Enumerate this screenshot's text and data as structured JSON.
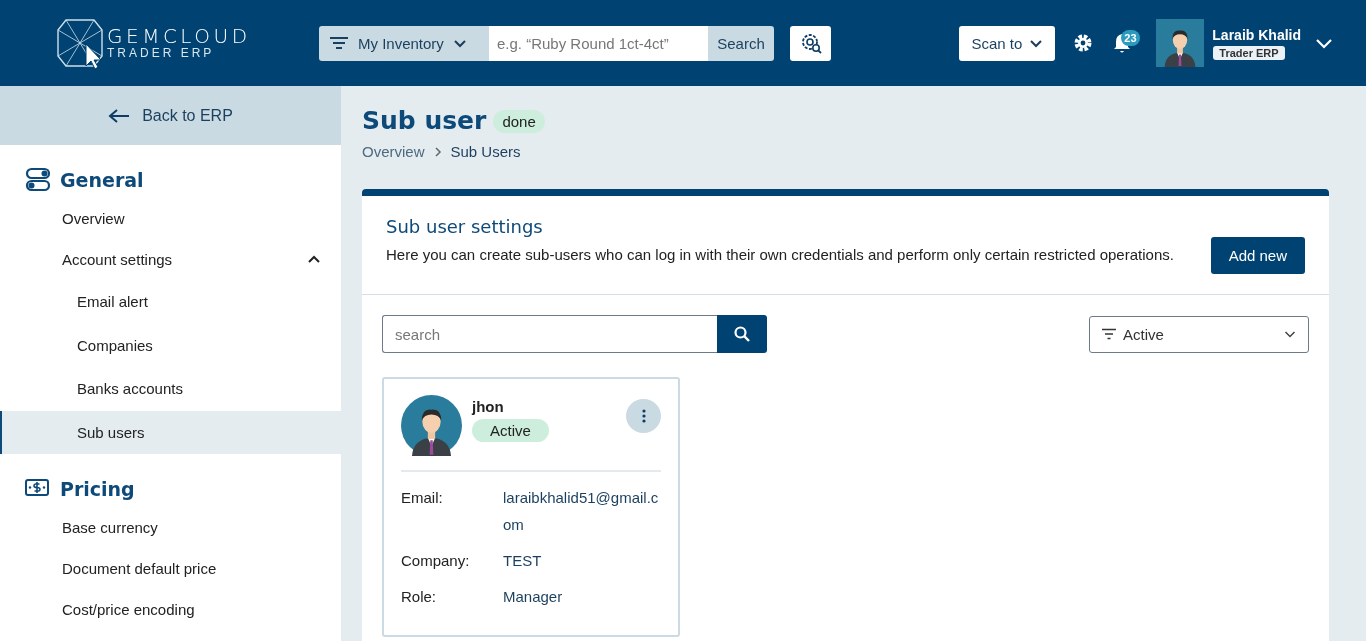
{
  "header": {
    "logo": {
      "name": "GEMCLOUD",
      "tagline": "TRADER ERP"
    },
    "search": {
      "scope": "My Inventory",
      "placeholder": "e.g. “Ruby Round 1ct-4ct”",
      "button": "Search"
    },
    "scan_button": "Scan to",
    "notifications": {
      "count": "23"
    },
    "user": {
      "name": "Laraib Khalid",
      "role": "Trader ERP"
    }
  },
  "sidebar": {
    "back": "Back to ERP",
    "sections": [
      {
        "title": "General",
        "kind": "toggles",
        "items": [
          {
            "label": "Overview",
            "selected": false
          },
          {
            "label": "Account settings",
            "selected": false,
            "expanded": true,
            "children": [
              {
                "label": "Email alert",
                "selected": false
              },
              {
                "label": "Companies",
                "selected": false
              },
              {
                "label": "Banks accounts",
                "selected": false
              },
              {
                "label": "Sub users",
                "selected": true
              }
            ]
          }
        ]
      },
      {
        "title": "Pricing",
        "kind": "money",
        "items": [
          {
            "label": "Base currency",
            "selected": false
          },
          {
            "label": "Document default price",
            "selected": false
          },
          {
            "label": "Cost/price encoding",
            "selected": false
          }
        ]
      }
    ]
  },
  "main": {
    "title": "Sub user",
    "badge": "done",
    "breadcrumb": [
      "Overview",
      "Sub Users"
    ],
    "card": {
      "title": "Sub user settings",
      "description": "Here you can create sub-users who can log in with their own credentials and perform only certain restricted operations.",
      "add_button": "Add new",
      "search": {
        "placeholder": "search"
      },
      "filter": {
        "value": "Active"
      },
      "users": [
        {
          "name": "jhon",
          "status": "Active",
          "fields": [
            {
              "label": "Email:",
              "value": "laraibkhalid51@gmail.com"
            },
            {
              "label": "Company:",
              "value": "TEST"
            },
            {
              "label": "Role:",
              "value": "Manager"
            }
          ]
        }
      ]
    }
  }
}
